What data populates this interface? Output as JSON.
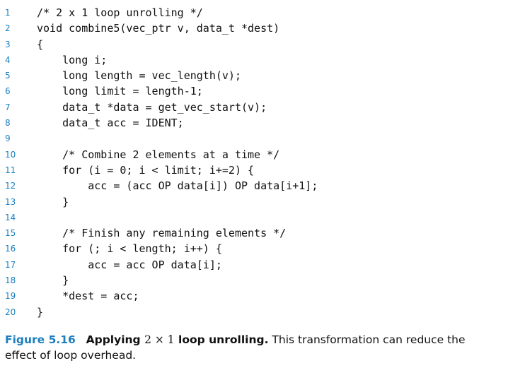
{
  "code_lines": [
    {
      "no": "1",
      "text": "/* 2 x 1 loop unrolling */"
    },
    {
      "no": "2",
      "text": "void combine5(vec_ptr v, data_t *dest)"
    },
    {
      "no": "3",
      "text": "{"
    },
    {
      "no": "4",
      "text": "    long i;"
    },
    {
      "no": "5",
      "text": "    long length = vec_length(v);"
    },
    {
      "no": "6",
      "text": "    long limit = length-1;"
    },
    {
      "no": "7",
      "text": "    data_t *data = get_vec_start(v);"
    },
    {
      "no": "8",
      "text": "    data_t acc = IDENT;"
    },
    {
      "no": "9",
      "text": ""
    },
    {
      "no": "10",
      "text": "    /* Combine 2 elements at a time */"
    },
    {
      "no": "11",
      "text": "    for (i = 0; i < limit; i+=2) {"
    },
    {
      "no": "12",
      "text": "        acc = (acc OP data[i]) OP data[i+1];"
    },
    {
      "no": "13",
      "text": "    }"
    },
    {
      "no": "14",
      "text": ""
    },
    {
      "no": "15",
      "text": "    /* Finish any remaining elements */"
    },
    {
      "no": "16",
      "text": "    for (; i < length; i++) {"
    },
    {
      "no": "17",
      "text": "        acc = acc OP data[i];"
    },
    {
      "no": "18",
      "text": "    }"
    },
    {
      "no": "19",
      "text": "    *dest = acc;"
    },
    {
      "no": "20",
      "text": "}"
    }
  ],
  "caption": {
    "label": "Figure 5.16",
    "title_before": "Applying ",
    "title_math": "2 × 1",
    "title_after": " loop unrolling.",
    "body": " This transformation can reduce the effect of loop overhead."
  },
  "colors": {
    "accent": "#1b7fc0",
    "text": "#111111"
  }
}
